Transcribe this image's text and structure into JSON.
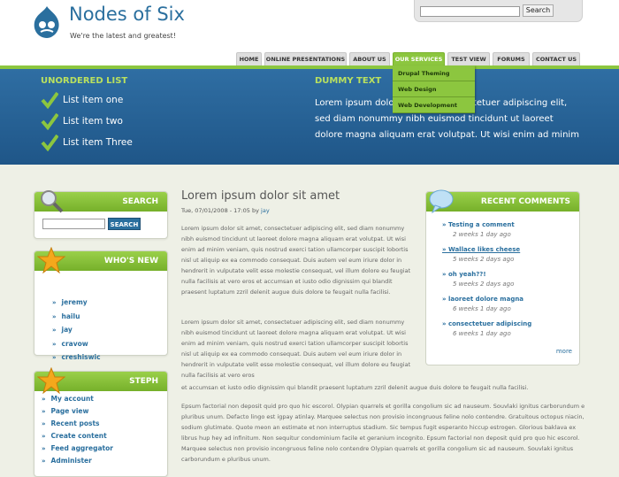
{
  "site": {
    "name": "Nodes of Six",
    "slogan": "We're the latest and greatest!"
  },
  "search_top": {
    "button": "Search",
    "value": ""
  },
  "nav": {
    "tabs": [
      "HOME",
      "ONLINE PRESENTATIONS",
      "ABOUT US",
      "OUR SERVICES",
      "TEST VIEW",
      "FORUMS",
      "CONTACT US"
    ],
    "dropdown": [
      "Drupal Theming",
      "Web Design",
      "Web Development"
    ]
  },
  "band": {
    "ul_title": "UNORDERED LIST",
    "items": [
      "List item one",
      "List item two",
      "List item Three"
    ],
    "dummy_title": "DUMMY TEXT",
    "dummy_text": "Lorem ipsum dolor sit amet, consectetuer adipiscing elit, sed diam nonummy nibh euismod tincidunt ut laoreet dolore magna aliquam erat volutpat. Ut wisi enim ad minim"
  },
  "search_box": {
    "title": "SEARCH",
    "button": "SEARCH"
  },
  "whos_new": {
    "title": "WHO'S NEW",
    "users": [
      "jeremy",
      "hailu",
      "jay",
      "cravow",
      "creshiswic"
    ]
  },
  "steph": {
    "title": "STEPH",
    "links": [
      "My account",
      "Page view",
      "Recent posts",
      "Create content",
      "Feed aggregator",
      "Administer"
    ]
  },
  "article": {
    "title": "Lorem ipsum dolor sit amet",
    "date": "Tue, 07/01/2008 - 17:05 by",
    "author": "jay",
    "p1": "Lorem ipsum dolor sit amet, consectetuer adipiscing elit, sed diam nonummy nibh euismod tincidunt ut laoreet dolore magna aliquam erat volutpat. Ut wisi enim ad minim veniam, quis nostrud exerci tation ullamcorper suscipit lobortis nisl ut aliquip ex ea commodo consequat. Duis autem vel eum iriure dolor in hendrerit in vulputate velit esse molestie consequat, vel illum dolore eu feugiat nulla facilisis at vero eros et accumsan et iusto odio dignissim qui blandit praesent luptatum zzril delenit augue duis dolore te feugait nulla facilisi.",
    "p2a": "Lorem ipsum dolor sit amet, consectetuer adipiscing elit, sed diam nonummy nibh euismod tincidunt ut laoreet dolore magna aliquam erat volutpat. Ut wisi enim ad minim veniam, quis nostrud exerci tation ullamcorper suscipit lobortis nisl ut aliquip ex ea commodo consequat. Duis autem vel eum iriure dolor in hendrerit in vulputate velit esse molestie consequat, vel illum dolore eu feugiat nulla facilisis at vero eros",
    "p2b": "et accumsan et iusto odio dignissim qui blandit praesent luptatum zzril delenit augue duis dolore te feugait nulla facilisi.",
    "p3": "Epsum factorial non deposit quid pro quo hic escorol. Olypian quarrels et gorilla congolium sic ad nauseum. Souvlaki ignitus carborundum e pluribus unum. Defacto lingo est igpay atinlay. Marquee selectus non provisio incongruous feline nolo contendre. Gratuitous octopus niacin, sodium glutimate. Quote meon an estimate et non interruptus stadium. Sic tempus fugit esperanto hiccup estrogen. Glorious baklava ex librus hup hey ad infinitum. Non sequitur condominium facile et geranium incognito. Epsum factorial non deposit quid pro quo hic escorol. Marquee selectus non provisio incongruous feline nolo contendre Olypian quarrels et gorilla congolium sic ad nauseum. Souvlaki ignitus carborundum e pluribus unum."
  },
  "recent": {
    "title": "RECENT COMMENTS",
    "items": [
      {
        "t": "Testing a comment",
        "d": "2 weeks 1 day ago"
      },
      {
        "t": "Wallace likes cheese",
        "d": "5 weeks 2 days ago"
      },
      {
        "t": "oh yeah??!",
        "d": "5 weeks 2 days ago"
      },
      {
        "t": "laoreet dolore magna",
        "d": "6 weeks 1 day ago"
      },
      {
        "t": "consectetuer adipiscing",
        "d": "6 weeks 1 day ago"
      }
    ],
    "more": "more"
  }
}
